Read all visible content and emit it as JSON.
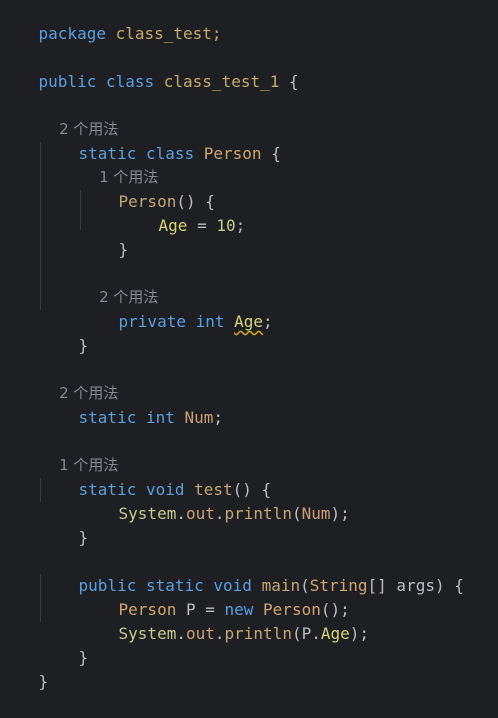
{
  "lines": {
    "package_kw": "package",
    "package_name": " class_test;",
    "class_decl_public": "public",
    "class_decl_class": " class ",
    "class_name": "class_test_1",
    "class_open": " {",
    "hint_person_usages": "2 个用法",
    "person_static": "static",
    "person_class": " class ",
    "person_name": "Person",
    "person_open": " {",
    "hint_ctor_usages": "1 个用法",
    "ctor_name": "Person",
    "ctor_sig": "() {",
    "age_assign_field": "Age",
    "age_assign_rest": " = ",
    "age_assign_value": "10",
    "age_assign_semi": ";",
    "ctor_close": "}",
    "hint_age_usages": "2 个用法",
    "age_private": "private",
    "age_int": " int ",
    "age_name": "Age",
    "age_semi": ";",
    "person_close": "}",
    "hint_num_usages": "2 个用法",
    "num_static": "static",
    "num_int": " int ",
    "num_name": "Num",
    "num_semi": ";",
    "hint_test_usages": "1 个用法",
    "test_static": "static",
    "test_void": " void ",
    "test_name": "test",
    "test_sig": "() {",
    "println1_system": "System",
    "println1_dot1": ".",
    "println1_out": "out",
    "println1_dot2": ".",
    "println1_method": "println",
    "println1_open": "(",
    "println1_arg": "Num",
    "println1_close": ");",
    "test_close": "}",
    "main_public": "public",
    "main_static": " static",
    "main_void": " void ",
    "main_name": "main",
    "main_paren_open": "(",
    "main_string": "String",
    "main_args": "[] args",
    "main_paren_close": ") {",
    "new_type": "Person",
    "new_var": " P = ",
    "new_kw": "new",
    "new_ctor": " Person",
    "new_rest": "();",
    "println2_system": "System",
    "println2_dot1": ".",
    "println2_out": "out",
    "println2_dot2": ".",
    "println2_method": "println",
    "println2_open": "(",
    "println2_arg": "P.",
    "println2_field": "Age",
    "println2_close": ");",
    "main_close": "}",
    "class_close": "}"
  }
}
